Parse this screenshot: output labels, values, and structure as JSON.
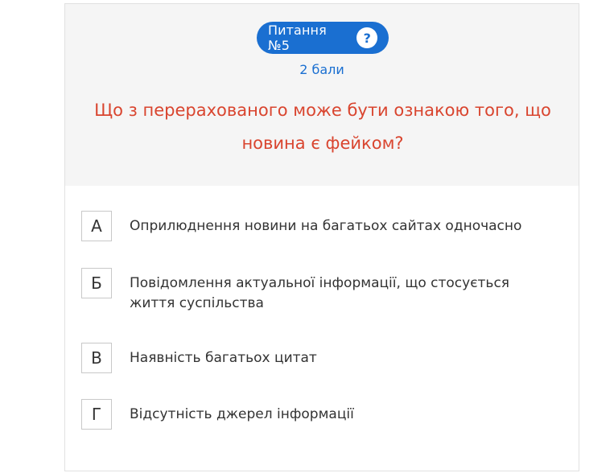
{
  "question": {
    "badge_label": "Питання №5",
    "help_glyph": "?",
    "points": "2 бали",
    "text": "Що з перерахованого може бути ознакою того, що новина є фейком?"
  },
  "options": [
    {
      "letter": "А",
      "text": "Оприлюднення новини на багатьох сайтах одночасно"
    },
    {
      "letter": "Б",
      "text": "Повідомлення актуальної інформації, що стосується життя суспільства"
    },
    {
      "letter": "В",
      "text": "Наявність багатьох цитат"
    },
    {
      "letter": "Г",
      "text": "Відсутність джерел інформації"
    }
  ],
  "colors": {
    "accent_blue": "#1a6fd1",
    "question_red": "#d9452f",
    "header_bg": "#f5f5f5",
    "text_dark": "#333333"
  }
}
